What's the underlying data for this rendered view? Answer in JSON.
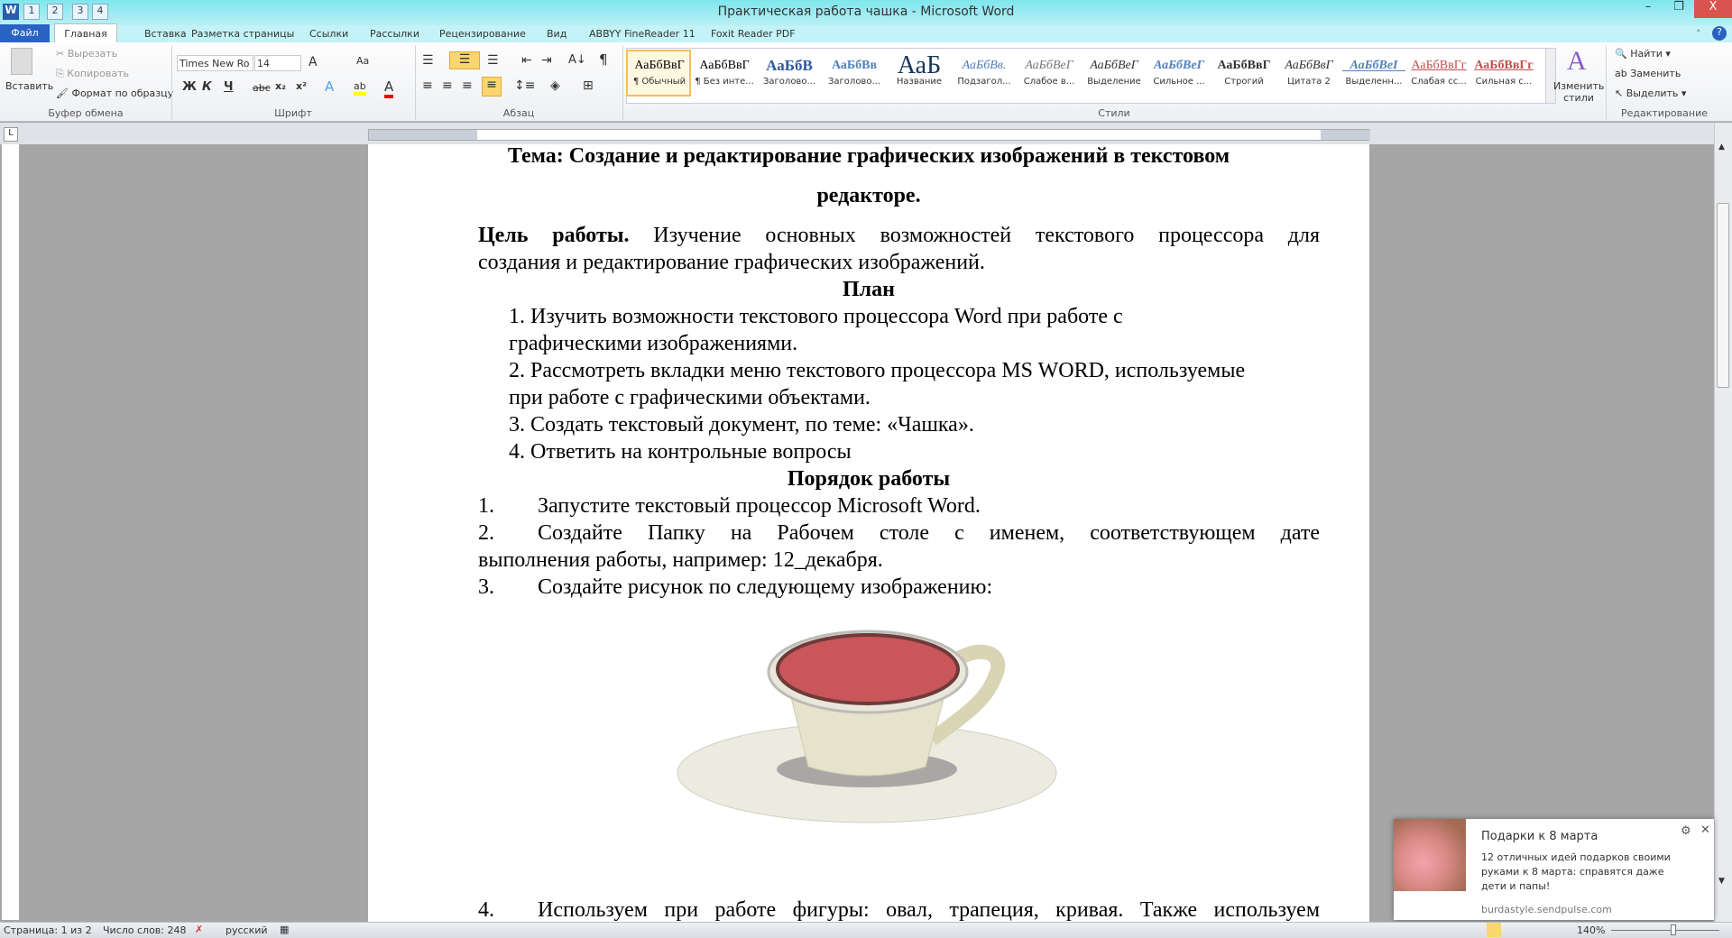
{
  "window": {
    "title": "Практическая работа чашка - Microsoft Word",
    "minimize": "–",
    "restore": "❐",
    "close": "X"
  },
  "quick_access": {
    "keys": [
      "1",
      "2",
      "3",
      "4"
    ]
  },
  "tabs": [
    {
      "label": "Файл",
      "key": "Ф"
    },
    {
      "label": "Главная",
      "key": "Я"
    },
    {
      "label": "Вставка",
      "key": "С"
    },
    {
      "label": "Разметка страницы",
      "key": "З"
    },
    {
      "label": "Ссылки",
      "key": "К"
    },
    {
      "label": "Рассылки",
      "key": "Л"
    },
    {
      "label": "Рецензирование",
      "key": "И"
    },
    {
      "label": "Вид",
      "key": "О"
    },
    {
      "label": "ABBYY FineReader 11",
      "key": "Э1"
    },
    {
      "label": "Foxit Reader PDF",
      "key": "Э2"
    }
  ],
  "clipboard": {
    "paste": "Вставить",
    "cut": "Вырезать",
    "copy": "Копировать",
    "format_painter": "Формат по образцу",
    "group": "Буфер обмена"
  },
  "font": {
    "name": "Times New Ro",
    "size": "14",
    "bold": "Ж",
    "italic": "К",
    "underline": "Ч",
    "strike": "abc",
    "sub": "x₂",
    "sup": "x²",
    "group": "Шрифт",
    "grow": "A",
    "case": "Aa"
  },
  "paragraph": {
    "group": "Абзац",
    "pilcrow": "¶"
  },
  "styles": {
    "group": "Стили",
    "items": [
      {
        "sample": "АаБбВвГ",
        "name": "¶ Обычный"
      },
      {
        "sample": "АаБбВвГ",
        "name": "¶ Без инте..."
      },
      {
        "sample": "АаБбВ",
        "name": "Заголово..."
      },
      {
        "sample": "АаБбВв",
        "name": "Заголово..."
      },
      {
        "sample": "АаБ",
        "name": "Название"
      },
      {
        "sample": "АаБбВв.",
        "name": "Подзагол..."
      },
      {
        "sample": "АаБбВеГ",
        "name": "Слабое в..."
      },
      {
        "sample": "АаБбВеГ",
        "name": "Выделение"
      },
      {
        "sample": "АаБбВеГ",
        "name": "Сильное ..."
      },
      {
        "sample": "АаБбВвГ",
        "name": "Строгий"
      },
      {
        "sample": "АаБбВвГ",
        "name": "Цитата 2"
      },
      {
        "sample": "АаБбВеІ",
        "name": "Выделенн..."
      },
      {
        "sample": "АаБбВвГг",
        "name": "Слабая сс..."
      },
      {
        "sample": "АаБбВвГг",
        "name": "Сильная с..."
      }
    ],
    "change": "Изменить стили"
  },
  "editing": {
    "group": "Редактирование",
    "find": "Найти",
    "replace": "Заменить",
    "select": "Выделить"
  },
  "document": {
    "title1": "Тема: Создание и редактирование графических изображений в текстовом",
    "title2": "редакторе.",
    "goal_label": "Цель работы.",
    "goal_text": " Изучение основных возможностей текстового процессора для",
    "goal_text2": "создания и редактирование графических изображений.",
    "plan": "План",
    "plan_items": [
      "1.  Изучить возможности текстового процессора Word при работе с",
      "графическими изображениями.",
      "2.  Рассмотреть вкладки меню текстового процессора MS WORD, используемые",
      "при работе с графическими объектами.",
      "3.  Создать текстовый документ, по теме: «Чашка».",
      "4.  Ответить на контрольные вопросы"
    ],
    "order": "Порядок работы",
    "steps": [
      {
        "n": "1.",
        "text": "Запустите текстовый процессор Microsoft Word."
      },
      {
        "n": "2.",
        "text": "Создайте Папку на Рабочем столе с именем, соответствующем дате"
      },
      {
        "n": "",
        "text": "выполнения работы, например: 12_декабря."
      },
      {
        "n": "3.",
        "text": "Создайте рисунок по следующему изображению:"
      },
      {
        "n": "4.",
        "text": "Используем при работе фигуры: овал, трапеция, кривая. Также используем"
      }
    ]
  },
  "status": {
    "page": "Страница: 1 из 2",
    "words": "Число слов: 248",
    "lang": "русский",
    "zoom": "140%"
  },
  "notification": {
    "title": "Подарки к 8 марта",
    "body": "12 отличных идей подарков своими руками к 8 марта: справятся даже дети и папы!",
    "source": "burdastyle.sendpulse.com"
  },
  "colors": {
    "accent": "#2a62c1",
    "tea": "#c9575a",
    "cup": "#e6e3cc"
  }
}
